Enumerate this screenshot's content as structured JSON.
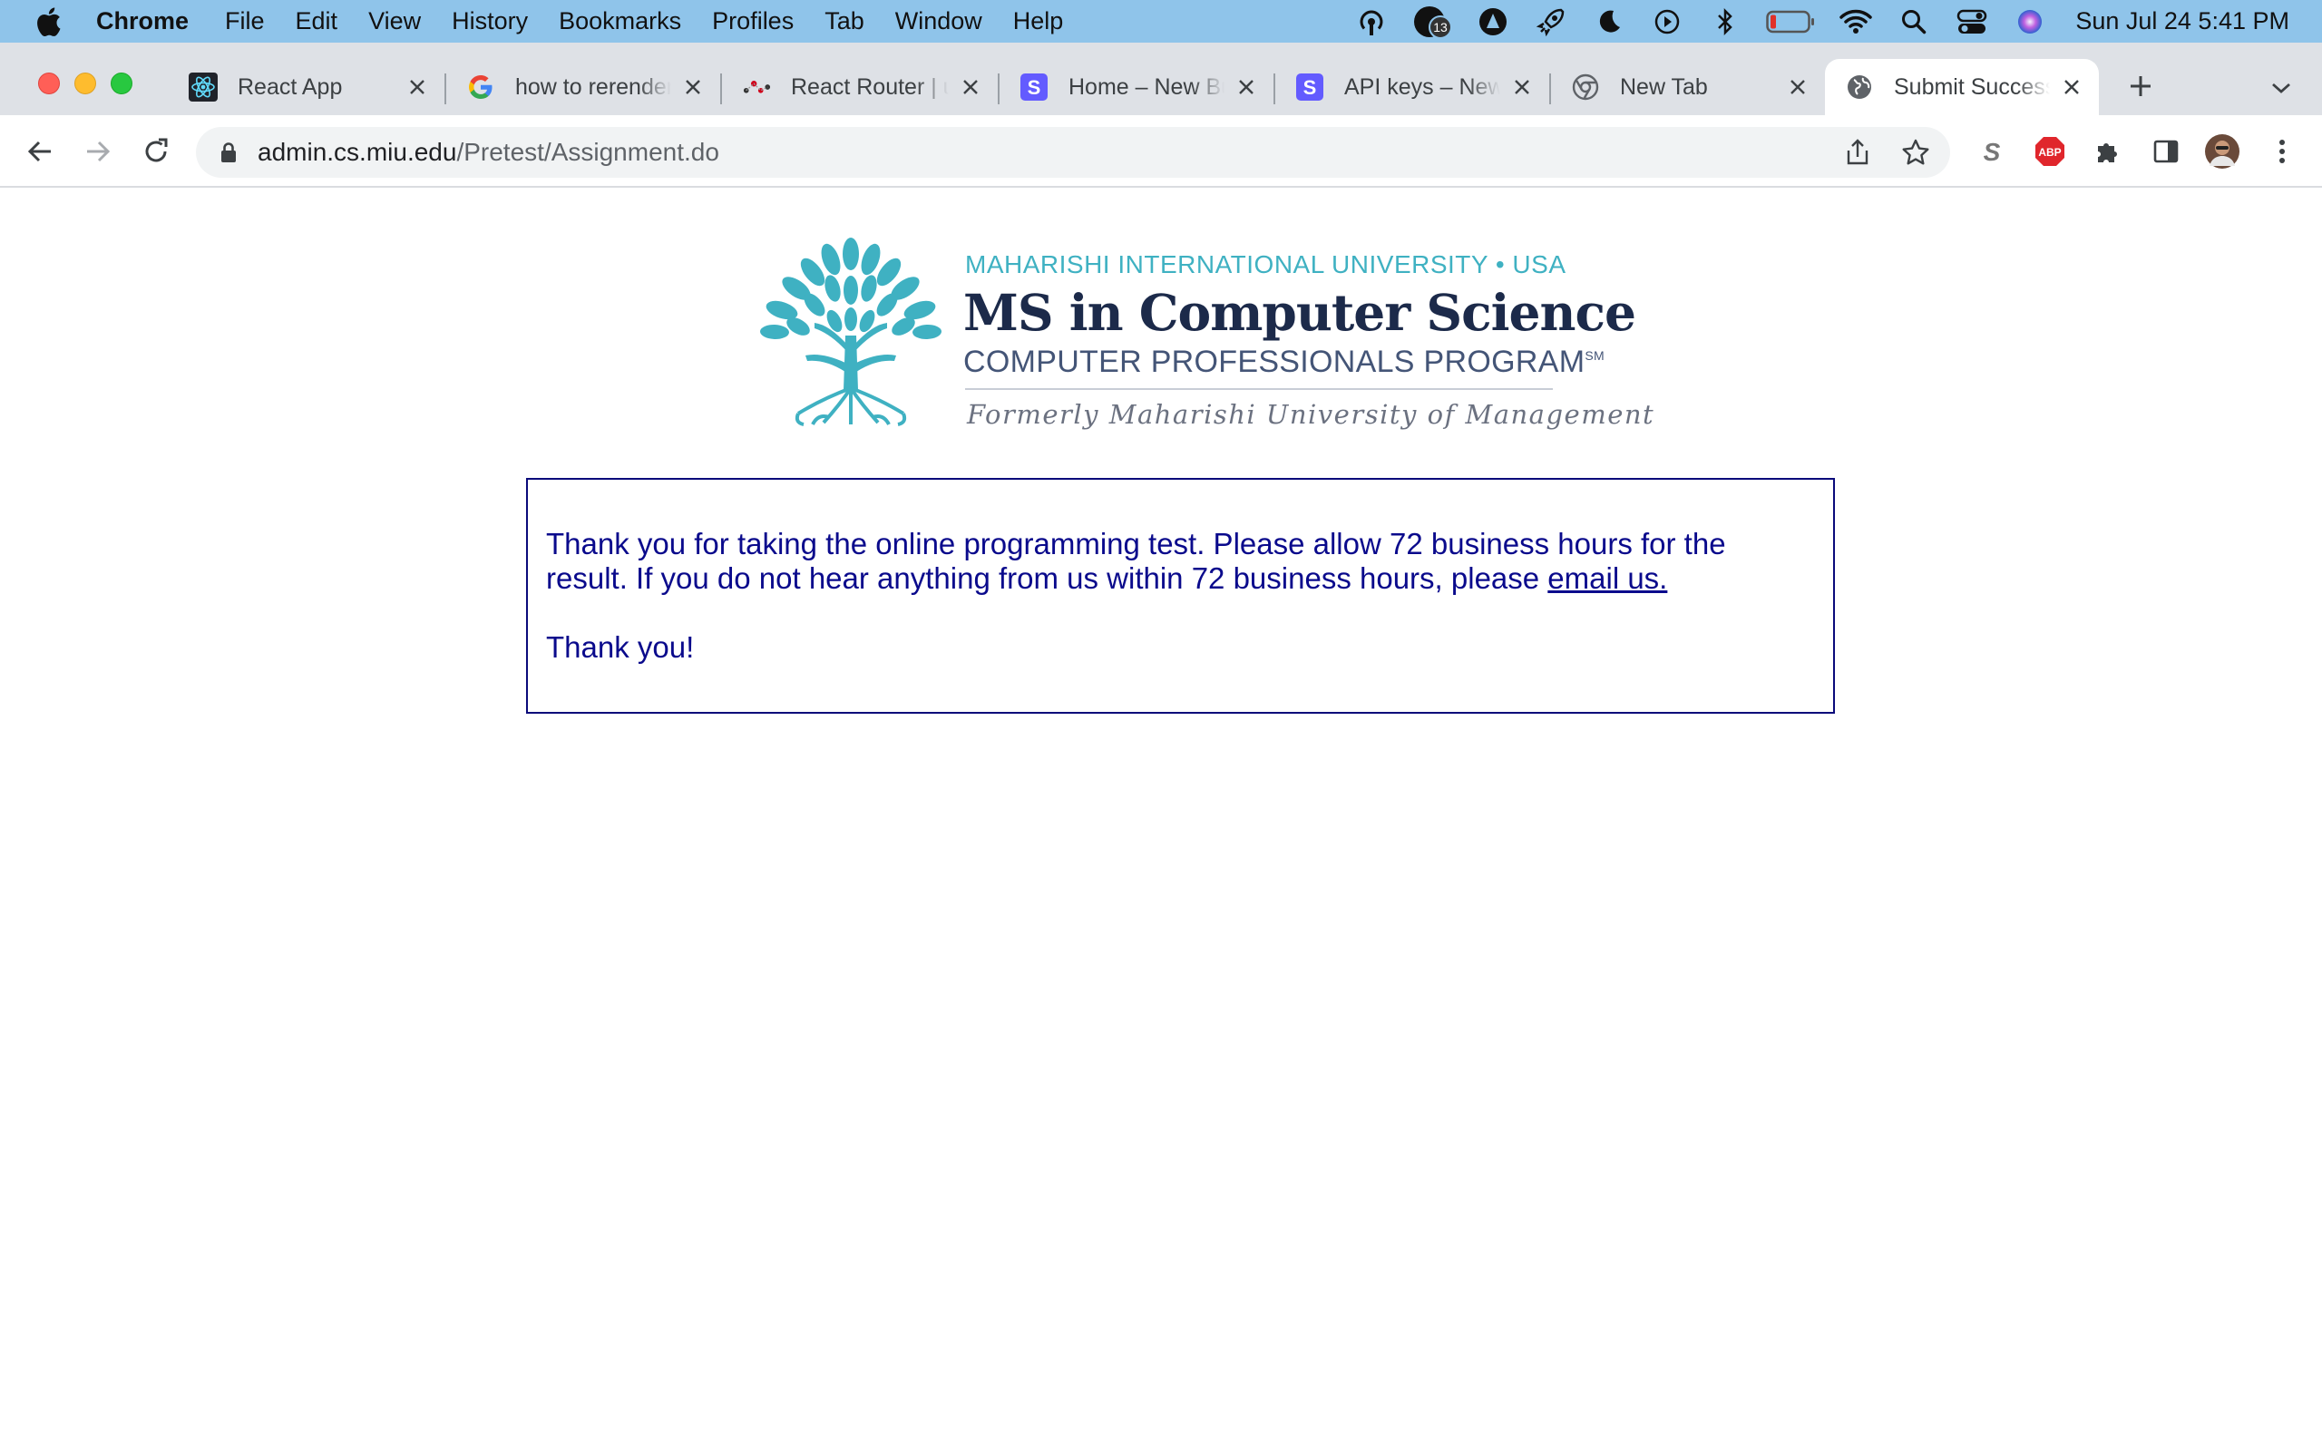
{
  "menubar": {
    "app_name": "Chrome",
    "items": [
      "File",
      "Edit",
      "View",
      "History",
      "Bookmarks",
      "Profiles",
      "Tab",
      "Window",
      "Help"
    ],
    "clock": "Sun Jul 24  5:41 PM",
    "badge_count": "13"
  },
  "tabs": [
    {
      "title": "React App",
      "icon": "react-icon"
    },
    {
      "title": "how to rerender",
      "icon": "google-icon"
    },
    {
      "title": "React Router | u",
      "icon": "react-router-icon"
    },
    {
      "title": "Home – New Bu",
      "icon": "stripe-icon"
    },
    {
      "title": "API keys – New",
      "icon": "stripe-icon"
    },
    {
      "title": "New Tab",
      "icon": "chrome-icon"
    },
    {
      "title": "Submit Success",
      "icon": "globe-icon",
      "active": true
    }
  ],
  "toolbar": {
    "url_host": "admin.cs.miu.edu",
    "url_path": "/Pretest/Assignment.do"
  },
  "logo": {
    "line1": "MAHARISHI INTERNATIONAL UNIVERSITY • USA",
    "line2": "MS in Computer Science",
    "line3": "COMPUTER PROFESSIONALS PROGRAM",
    "line3_mark": "SM",
    "line4": "Formerly Maharishi University of Management"
  },
  "message": {
    "text": "Thank you for taking the online programming test. Please allow 72 business hours for the result. If you do not hear anything from us within 72 business hours, please ",
    "link": "email us.",
    "thanks": "Thank you!"
  },
  "colors": {
    "menubar": "#8fc4ea",
    "tabstrip": "#dee1e6",
    "message_text": "#0a0a8c",
    "logo_teal": "#3fb1c2",
    "logo_navy": "#1c2a4a"
  }
}
